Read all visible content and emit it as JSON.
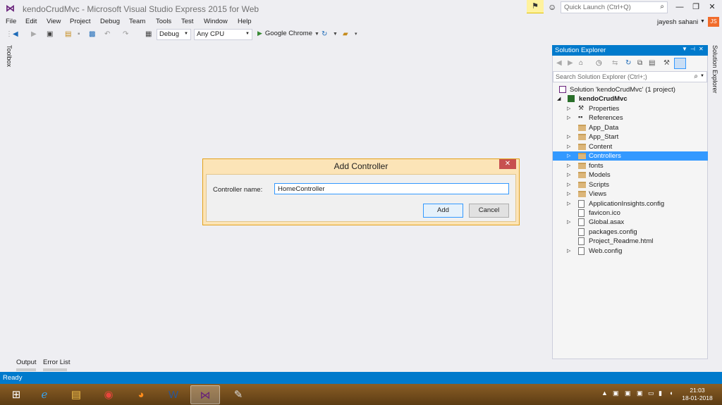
{
  "window": {
    "title": "kendoCrudMvc - Microsoft Visual Studio Express 2015 for Web",
    "quick_launch_placeholder": "Quick Launch (Ctrl+Q)",
    "user_name": "jayesh sahani",
    "user_initials": "JS"
  },
  "menu": [
    "File",
    "Edit",
    "View",
    "Project",
    "Debug",
    "Team",
    "Tools",
    "Test",
    "Window",
    "Help"
  ],
  "toolbar": {
    "config": "Debug",
    "platform": "Any CPU",
    "run_target": "Google Chrome"
  },
  "toolbox_label": "Toolbox",
  "solution_explorer": {
    "title": "Solution Explorer",
    "side_tab": "Solution Explorer",
    "search_placeholder": "Search Solution Explorer (Ctrl+;)",
    "solution": "Solution 'kendoCrudMvc' (1 project)",
    "project": "kendoCrudMvc",
    "items": [
      {
        "label": "Properties",
        "icon": "wrench-icon",
        "expandable": true
      },
      {
        "label": "References",
        "icon": "references-icon",
        "expandable": true
      },
      {
        "label": "App_Data",
        "icon": "folder-icon",
        "expandable": false
      },
      {
        "label": "App_Start",
        "icon": "folder-icon",
        "expandable": true
      },
      {
        "label": "Content",
        "icon": "folder-icon",
        "expandable": true
      },
      {
        "label": "Controllers",
        "icon": "folder-icon",
        "expandable": true,
        "selected": true
      },
      {
        "label": "fonts",
        "icon": "folder-icon",
        "expandable": true
      },
      {
        "label": "Models",
        "icon": "folder-icon",
        "expandable": true
      },
      {
        "label": "Scripts",
        "icon": "folder-icon",
        "expandable": true
      },
      {
        "label": "Views",
        "icon": "folder-icon",
        "expandable": true
      },
      {
        "label": "ApplicationInsights.config",
        "icon": "config-file-icon",
        "expandable": true
      },
      {
        "label": "favicon.ico",
        "icon": "file-icon",
        "expandable": false
      },
      {
        "label": "Global.asax",
        "icon": "file-icon",
        "expandable": true
      },
      {
        "label": "packages.config",
        "icon": "config-file-icon",
        "expandable": false
      },
      {
        "label": "Project_Readme.html",
        "icon": "html-file-icon",
        "expandable": false
      },
      {
        "label": "Web.config",
        "icon": "config-file-icon",
        "expandable": true
      }
    ]
  },
  "dialog": {
    "title": "Add Controller",
    "field_label": "Controller name:",
    "field_value": "HomeController",
    "add_label": "Add",
    "cancel_label": "Cancel"
  },
  "bottom_tabs": [
    "Output",
    "Error List"
  ],
  "status": "Ready",
  "taskbar": {
    "time": "21:03",
    "date": "18-01-2018"
  },
  "colors": {
    "accent": "#007acc",
    "selection": "#3399ff",
    "dialog_border": "#e3a21a"
  }
}
